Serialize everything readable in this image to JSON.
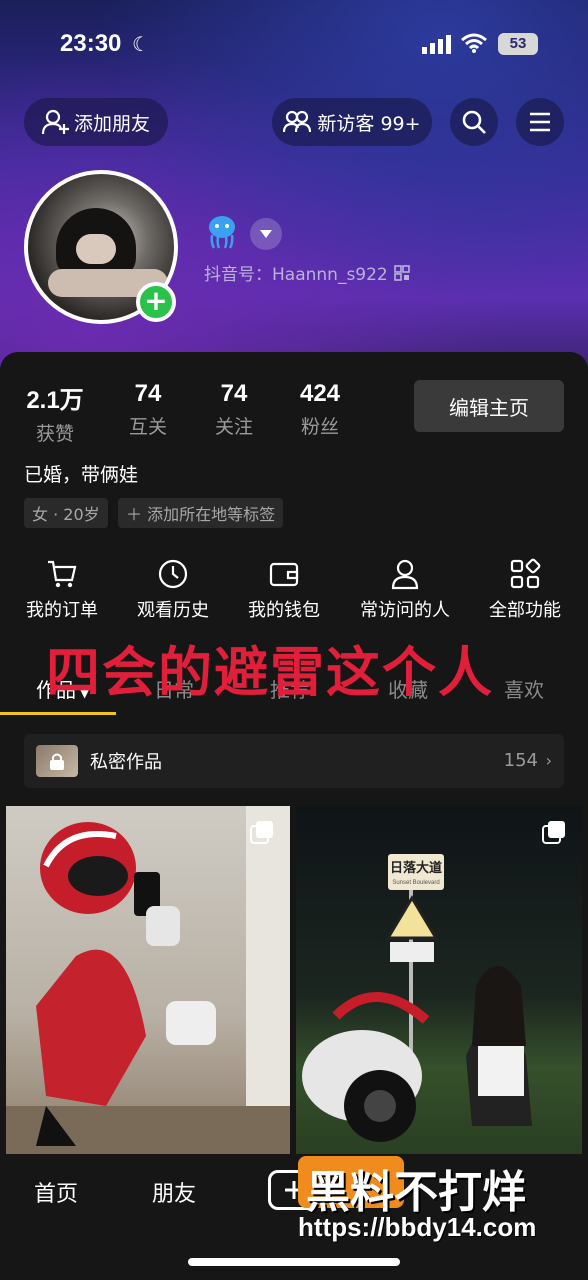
{
  "status_bar": {
    "time": "23:30",
    "battery": "53"
  },
  "header": {
    "add_friend": "添加朋友",
    "new_visitors": "新访客 99+"
  },
  "profile": {
    "douyin_id": "抖音号：Haannn_s922"
  },
  "stats": [
    {
      "num": "2.1万",
      "label": "获赞"
    },
    {
      "num": "74",
      "label": "互关"
    },
    {
      "num": "74",
      "label": "关注"
    },
    {
      "num": "424",
      "label": "粉丝"
    }
  ],
  "edit_profile": "编辑主页",
  "bio": "已婚，带俩娃",
  "tags": [
    "女 · 20岁",
    "＋ 添加所在地等标签"
  ],
  "quick_actions": [
    "我的订单",
    "观看历史",
    "我的钱包",
    "常访问的人",
    "全部功能"
  ],
  "overlay_caption": "四会的避雷这个人",
  "tabs": [
    "作品",
    "日常",
    "推荐",
    "收藏",
    "喜欢"
  ],
  "private_works": {
    "title": "私密作品",
    "count": "154"
  },
  "video_sign": {
    "cn": "日落大道",
    "en": "Sunset Boulevard"
  },
  "bottom_nav": [
    "首页",
    "朋友"
  ],
  "watermark": {
    "text": "黑料不打烊",
    "url": "https://bbdy14.com"
  }
}
